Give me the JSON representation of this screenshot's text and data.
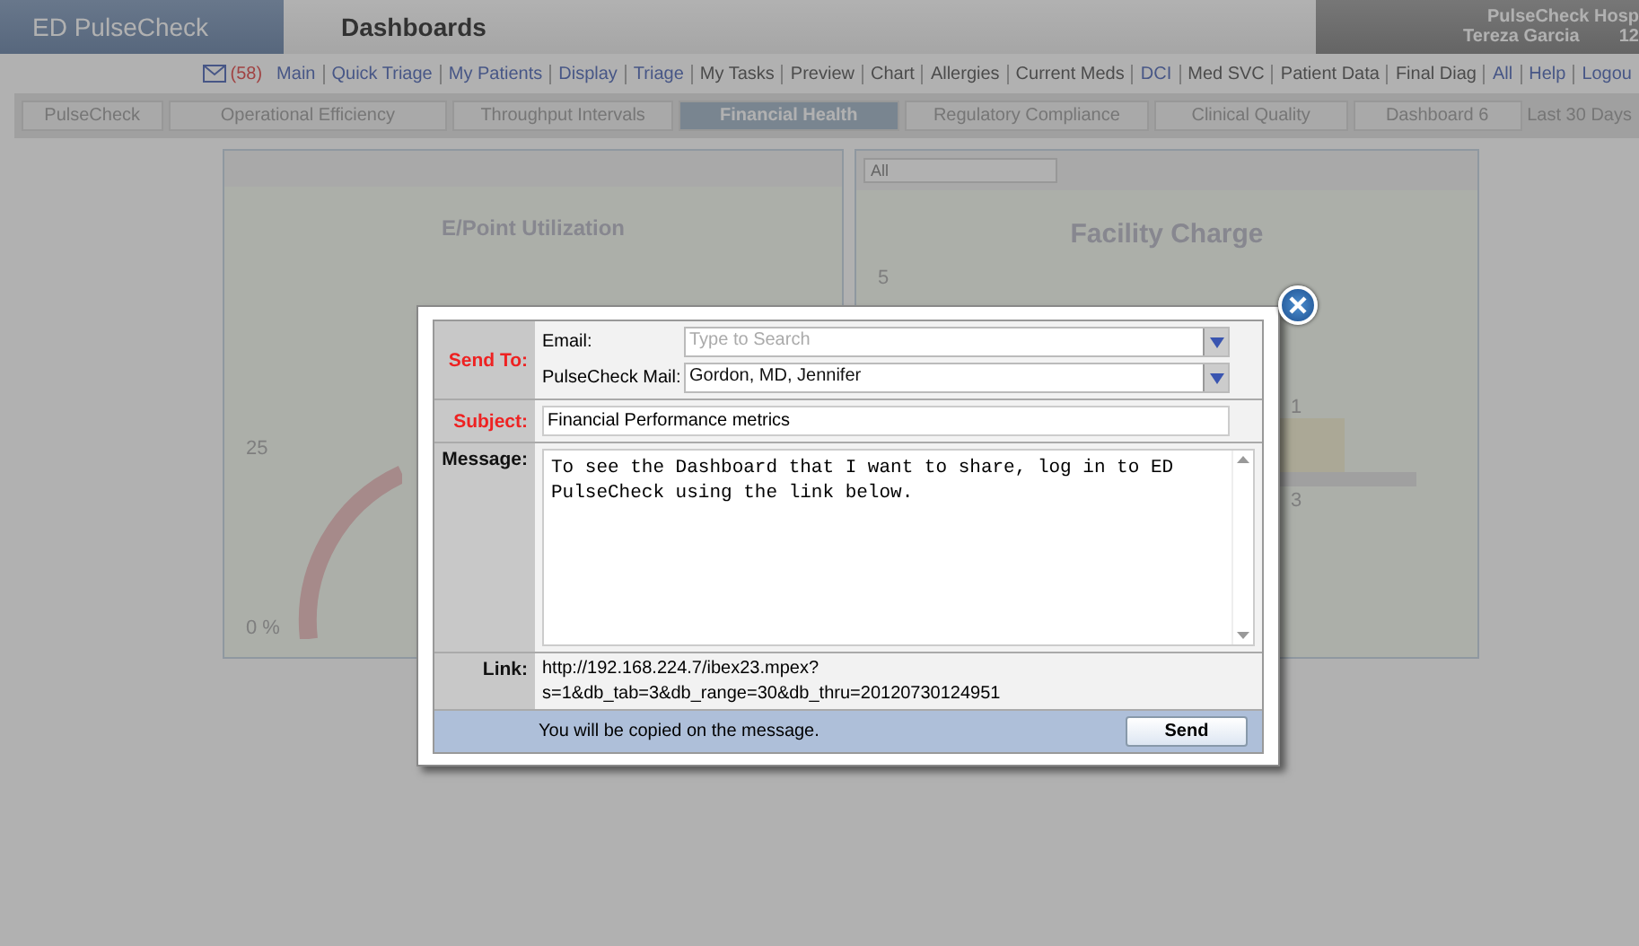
{
  "header": {
    "app_name": "ED PulseCheck",
    "page_title": "Dashboards",
    "facility": "PulseCheck Hosp",
    "user": "Tereza Garcia",
    "user_extra": "12"
  },
  "nav": {
    "mail_count": "(58)",
    "links": [
      {
        "label": "Main",
        "kind": "link"
      },
      {
        "label": "Quick Triage",
        "kind": "link"
      },
      {
        "label": "My Patients",
        "kind": "link"
      },
      {
        "label": "Display",
        "kind": "link"
      },
      {
        "label": "Triage",
        "kind": "link"
      },
      {
        "label": "My Tasks",
        "kind": "plain"
      },
      {
        "label": "Preview",
        "kind": "plain"
      },
      {
        "label": "Chart",
        "kind": "plain"
      },
      {
        "label": "Allergies",
        "kind": "plain"
      },
      {
        "label": "Current Meds",
        "kind": "plain"
      },
      {
        "label": "DCI",
        "kind": "link"
      },
      {
        "label": "Med SVC",
        "kind": "plain"
      },
      {
        "label": "Patient Data",
        "kind": "plain"
      },
      {
        "label": "Final Diag",
        "kind": "plain"
      },
      {
        "label": "All",
        "kind": "link"
      },
      {
        "label": "Help",
        "kind": "link"
      },
      {
        "label": "Logou",
        "kind": "link"
      }
    ]
  },
  "tabs": [
    {
      "label": "PulseCheck",
      "selected": false
    },
    {
      "label": "Operational Efficiency",
      "selected": false
    },
    {
      "label": "Throughput Intervals",
      "selected": false
    },
    {
      "label": "Financial Health",
      "selected": true
    },
    {
      "label": "Regulatory Compliance",
      "selected": false
    },
    {
      "label": "Clinical Quality",
      "selected": false
    },
    {
      "label": "Dashboard 6",
      "selected": false
    }
  ],
  "range": "Last 30 Days",
  "panels": [
    {
      "kind": "gauge",
      "title": "E/Point Utilization",
      "labels": [
        "25",
        "0 %"
      ]
    },
    {
      "kind": "bars",
      "title": "Facility Charge",
      "filter": "All",
      "labels": [
        "5",
        "1",
        "3"
      ]
    }
  ],
  "dialog": {
    "send_to_label": "Send To:",
    "email_label": "Email:",
    "email_placeholder": "Type to Search",
    "mail_label": "PulseCheck Mail:",
    "mail_value": "Gordon, MD, Jennifer",
    "subject_label": "Subject:",
    "subject_value": "Financial Performance metrics",
    "message_label": "Message:",
    "message_value": "To see the Dashboard that I want to share, log in to ED PulseCheck using the link below.",
    "link_label": "Link:",
    "link_lines": [
      "http://192.168.224.7/ibex23.mpex?",
      "s=1&db_tab=3&db_range=30&db_thru=20120730124951"
    ],
    "note": "You will be copied on the message.",
    "send": "Send"
  }
}
